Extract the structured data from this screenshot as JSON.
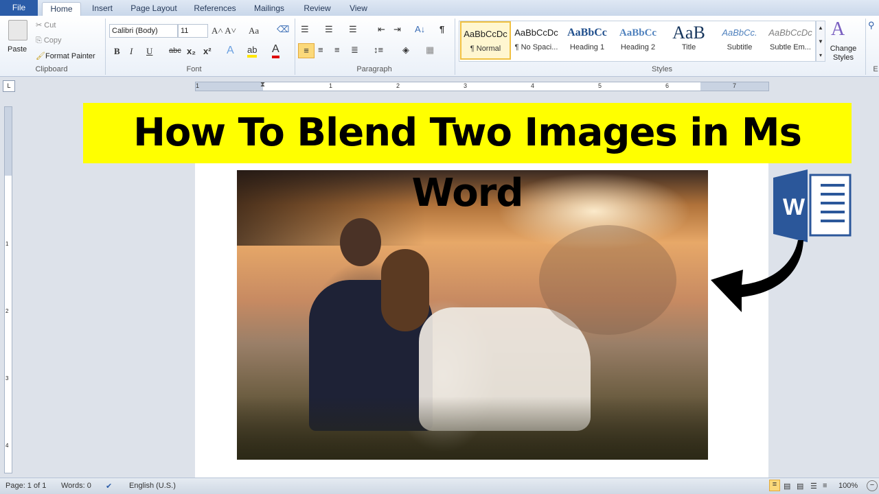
{
  "tabs": [
    "File",
    "Home",
    "Insert",
    "Page Layout",
    "References",
    "Mailings",
    "Review",
    "View"
  ],
  "clipboard": {
    "paste": "Paste",
    "cut": "Cut",
    "copy": "Copy",
    "format_painter": "Format Painter",
    "label": "Clipboard"
  },
  "font": {
    "name": "Calibri (Body)",
    "size": "11",
    "label": "Font",
    "bold": "B",
    "italic": "I",
    "underline": "U",
    "strike": "abc",
    "sub": "x₂",
    "sup": "x²",
    "change_case": "Aa"
  },
  "paragraph": {
    "label": "Paragraph",
    "pilcrow": "¶"
  },
  "styles": {
    "label": "Styles",
    "items": [
      {
        "preview": "AaBbCcDc",
        "name": "¶ Normal",
        "color": "#000000"
      },
      {
        "preview": "AaBbCcDc",
        "name": "¶ No Spaci...",
        "color": "#000000"
      },
      {
        "preview": "AaBbCc",
        "name": "Heading 1",
        "color": "#1f4e8c"
      },
      {
        "preview": "AaBbCc",
        "name": "Heading 2",
        "color": "#4f81bd"
      },
      {
        "preview": "AaB",
        "name": "Title",
        "color": "#17365d"
      },
      {
        "preview": "AaBbCc.",
        "name": "Subtitle",
        "color": "#4f81bd"
      },
      {
        "preview": "AaBbCcDc",
        "name": "Subtle Em...",
        "color": "#808080"
      }
    ],
    "change_styles": "Change Styles"
  },
  "editing_label": "E",
  "ruler_numbers": [
    "1",
    "1",
    "2",
    "3",
    "4",
    "5",
    "6",
    "7"
  ],
  "vruler_numbers": [
    "1",
    "2",
    "3",
    "4"
  ],
  "banner": "How To Blend Two Images in Ms Word",
  "word_logo_letter": "W",
  "status": {
    "page": "Page: 1 of 1",
    "words": "Words: 0",
    "language": "English (U.S.)",
    "zoom": "100%"
  }
}
